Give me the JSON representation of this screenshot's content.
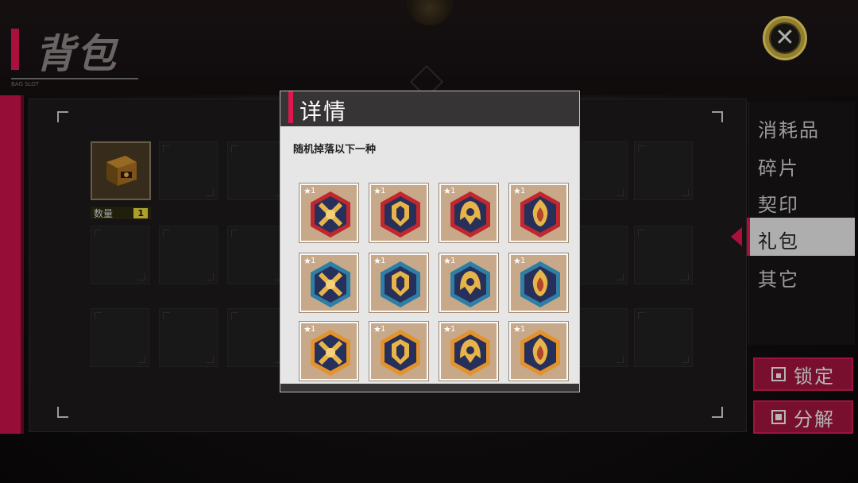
{
  "header": {
    "title": "背包",
    "subtitle": "BAG SLOT"
  },
  "tabs": [
    {
      "label": "消耗品",
      "active": false
    },
    {
      "label": "碎片",
      "active": false
    },
    {
      "label": "契印",
      "active": false
    },
    {
      "label": "礼包",
      "active": true
    },
    {
      "label": "其它",
      "active": false
    }
  ],
  "actions": {
    "lock_label": "锁定",
    "split_label": "分解"
  },
  "inventory": {
    "item": {
      "name": "gift-box",
      "qty_label": "数量",
      "qty_value": "1"
    }
  },
  "modal": {
    "title": "详情",
    "description": "随机掉落以下一种",
    "rows": [
      {
        "rim": "#c1272d",
        "items": [
          "cross-emblem",
          "crest-emblem",
          "helm-emblem",
          "flame-emblem"
        ]
      },
      {
        "rim": "#2e7fa6",
        "items": [
          "cross-emblem",
          "crest-emblem",
          "helm-emblem",
          "flame-emblem"
        ]
      },
      {
        "rim": "#e3922c",
        "items": [
          "cross-emblem",
          "crest-emblem",
          "helm-emblem",
          "flame-emblem"
        ]
      }
    ],
    "badge_star": "★",
    "badge_num": "1"
  },
  "colors": {
    "accent": "#e0174f",
    "panel": "#1c1a1b",
    "gold": "#e3d63a"
  }
}
